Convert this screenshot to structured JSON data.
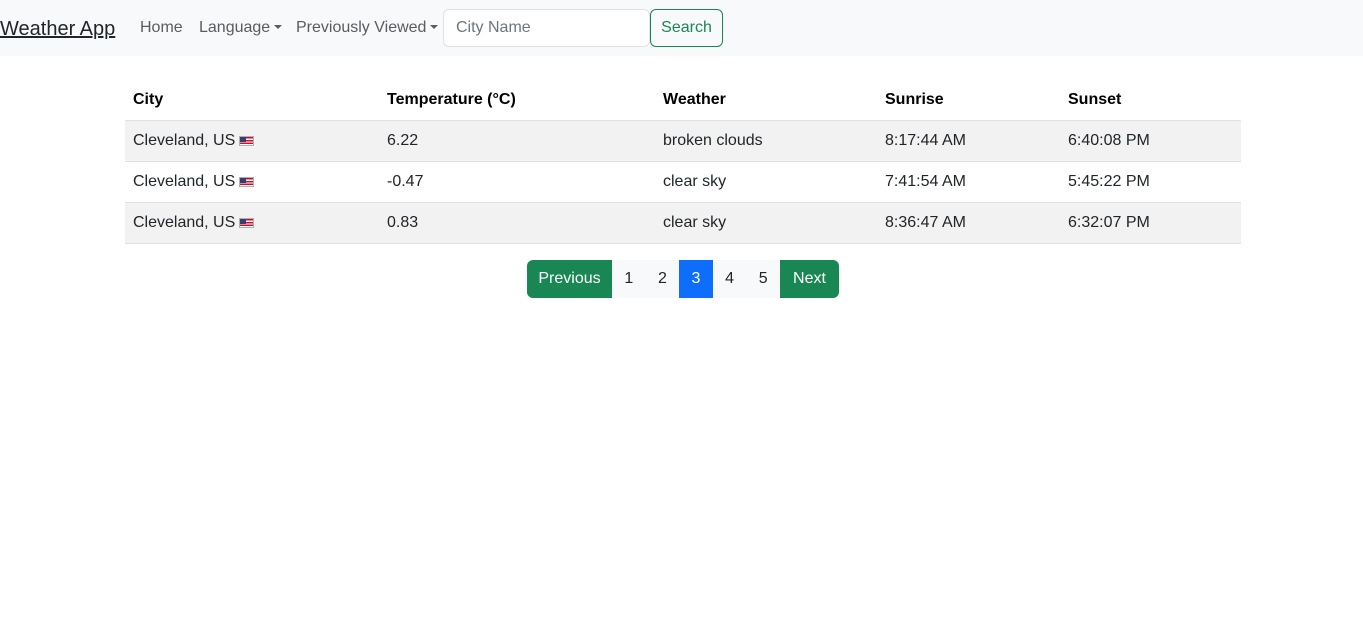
{
  "navbar": {
    "brand": "Weather App",
    "home": "Home",
    "language": "Language",
    "previously_viewed": "Previously Viewed",
    "search_placeholder": "City Name",
    "search_value": "",
    "search_button": "Search"
  },
  "table": {
    "headers": [
      "City",
      "Temperature (°C)",
      "Weather",
      "Sunrise",
      "Sunset"
    ],
    "rows": [
      {
        "city": "Cleveland, US",
        "flag": "us-flag-icon",
        "temperature": "6.22",
        "weather": "broken clouds",
        "sunrise": "8:17:44 AM",
        "sunset": "6:40:08 PM"
      },
      {
        "city": "Cleveland, US",
        "flag": "us-flag-icon",
        "temperature": "-0.47",
        "weather": "clear sky",
        "sunrise": "7:41:54 AM",
        "sunset": "5:45:22 PM"
      },
      {
        "city": "Cleveland, US",
        "flag": "us-flag-icon",
        "temperature": "0.83",
        "weather": "clear sky",
        "sunrise": "8:36:47 AM",
        "sunset": "6:32:07 PM"
      }
    ]
  },
  "pagination": {
    "previous": "Previous",
    "pages": [
      "1",
      "2",
      "3",
      "4",
      "5"
    ],
    "current": "3",
    "next": "Next"
  },
  "colors": {
    "navbar_bg": "#f8f9fa",
    "success": "#198754",
    "primary_active": "#0d6efd",
    "stripe": "#f2f2f2"
  }
}
